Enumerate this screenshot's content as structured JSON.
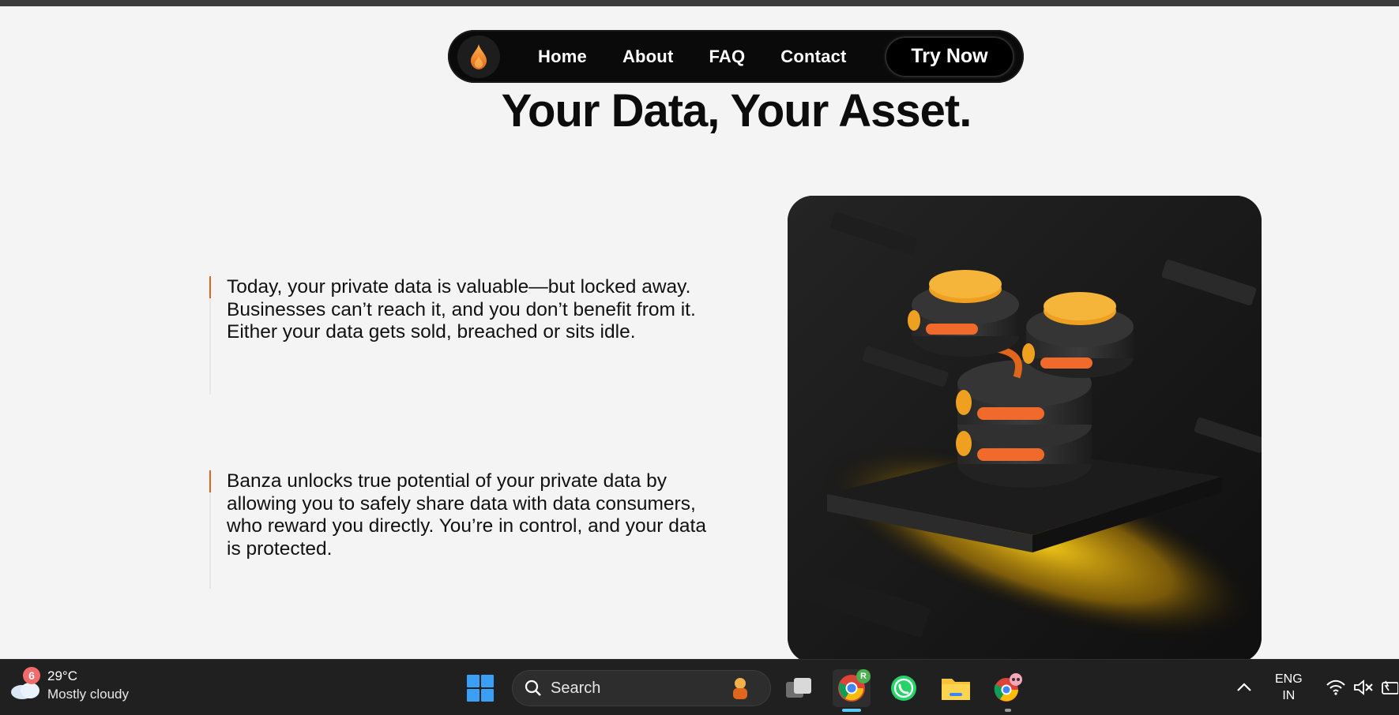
{
  "nav": {
    "logo": "flame-logo",
    "links": [
      "Home",
      "About",
      "FAQ",
      "Contact"
    ],
    "cta_label": "Try Now"
  },
  "hero": {
    "title": "Your Data, Your Asset.",
    "paragraphs": [
      "Today, your private data is valuable—but locked away. Businesses can’t reach it, and you don’t benefit from it. Either your data gets sold, breached or sits idle.",
      "Banza unlocks true potential of your private data by allowing you to safely share data with data consumers, who reward you directly. You’re in control, and your data is protected."
    ],
    "accent_color": "#e0661b"
  },
  "taskbar": {
    "weather": {
      "badge": "6",
      "temp": "29°C",
      "desc": "Mostly cloudy"
    },
    "search_placeholder": "Search",
    "apps": [
      "task-view",
      "chrome",
      "whatsapp",
      "file-explorer",
      "chrome-profile"
    ],
    "chrome_badge": "R",
    "lang_line1": "ENG",
    "lang_line2": "IN"
  }
}
